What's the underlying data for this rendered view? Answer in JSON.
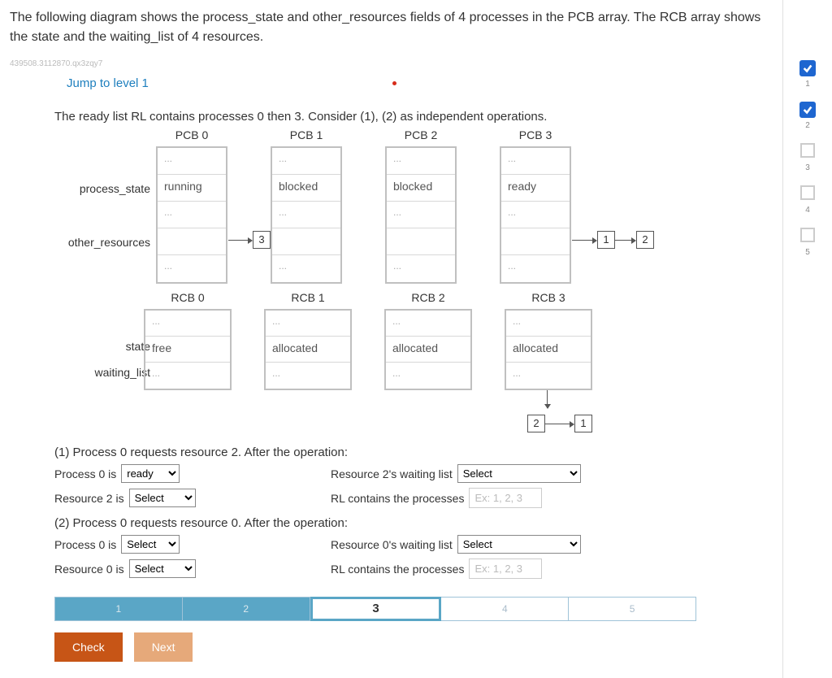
{
  "intro": "The following diagram shows the process_state and other_resources fields of 4 processes in the PCB array. The RCB array shows the state and the waiting_list of 4 resources.",
  "code_id": "439508.3112870.qx3zqy7",
  "jump": "Jump to level 1",
  "ready_text": "The ready list RL contains processes 0 then 3. Consider (1), (2) as independent operations.",
  "row_labels": {
    "ps": "process_state",
    "or": "other_resources",
    "st": "state",
    "wl": "waiting_list"
  },
  "pcb": [
    {
      "title": "PCB 0",
      "r0": "...",
      "state": "running",
      "mid": "...",
      "bot": "..."
    },
    {
      "title": "PCB 1",
      "r0": "...",
      "state": "blocked",
      "mid": "...",
      "bot": "..."
    },
    {
      "title": "PCB 2",
      "r0": "...",
      "state": "blocked",
      "mid": "...",
      "bot": "..."
    },
    {
      "title": "PCB 3",
      "r0": "...",
      "state": "ready",
      "mid": "...",
      "bot": "..."
    }
  ],
  "pcb_links": {
    "p0_res": "3",
    "p3_res1": "1",
    "p3_res2": "2"
  },
  "rcb": [
    {
      "title": "RCB 0",
      "r0": "...",
      "state": "free",
      "wl": "..."
    },
    {
      "title": "RCB 1",
      "r0": "...",
      "state": "allocated",
      "wl": "..."
    },
    {
      "title": "RCB 2",
      "r0": "...",
      "state": "allocated",
      "wl": "..."
    },
    {
      "title": "RCB 3",
      "r0": "...",
      "state": "allocated",
      "wl": "..."
    }
  ],
  "rcb_links": {
    "r3_w1": "2",
    "r3_w2": "1"
  },
  "q1": {
    "heading": "(1) Process 0 requests resource 2. After the operation:",
    "l1": "Process 0 is",
    "v1": "ready",
    "l2": "Resource 2's waiting list",
    "v2": "Select",
    "l3": "Resource 2 is",
    "v3": "Select",
    "l4": "RL contains the processes",
    "ph4": "Ex: 1, 2, 3"
  },
  "q2": {
    "heading": "(2) Process 0 requests resource 0. After the operation:",
    "l1": "Process 0 is",
    "v1": "Select",
    "l2": "Resource 0's waiting list",
    "v2": "Select",
    "l3": "Resource 0 is",
    "v3": "Select",
    "l4": "RL contains the processes",
    "ph4": "Ex: 1, 2, 3"
  },
  "steps": [
    "1",
    "2",
    "3",
    "4",
    "5"
  ],
  "current_step": 3,
  "buttons": {
    "check": "Check",
    "next": "Next"
  },
  "rail": [
    {
      "type": "check",
      "num": "1"
    },
    {
      "type": "check",
      "num": "2"
    },
    {
      "type": "box",
      "num": "3"
    },
    {
      "type": "box",
      "num": "4"
    },
    {
      "type": "box",
      "num": "5"
    }
  ]
}
